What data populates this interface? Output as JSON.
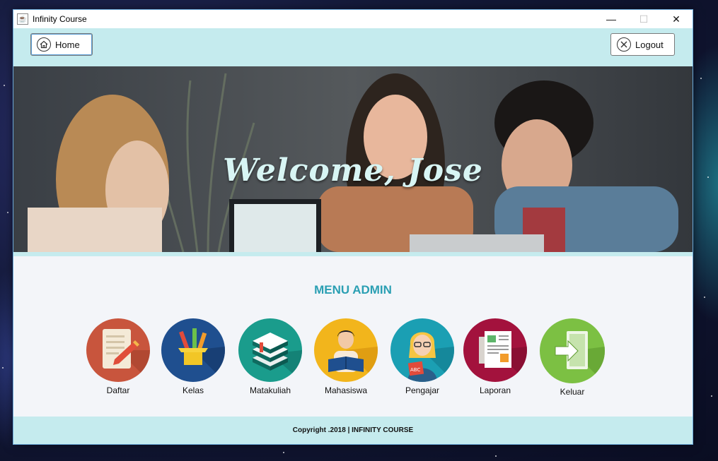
{
  "window": {
    "title": "Infinity Course",
    "controls": {
      "minimize": "—",
      "maximize": "☐",
      "close": "✕"
    }
  },
  "toolbar": {
    "home_label": "Home",
    "logout_label": "Logout"
  },
  "banner": {
    "welcome_text": "Welcome, Jose"
  },
  "menu": {
    "title": "MENU ADMIN",
    "items": [
      {
        "label": "Daftar",
        "icon": "registration-form-icon",
        "color": "#c8553d"
      },
      {
        "label": "Kelas",
        "icon": "pencil-cup-icon",
        "color": "#1f4f8f"
      },
      {
        "label": "Matakuliah",
        "icon": "books-icon",
        "color": "#1a9c8c"
      },
      {
        "label": "Mahasiswa",
        "icon": "student-reading-icon",
        "color": "#f2b51c"
      },
      {
        "label": "Pengajar",
        "icon": "teacher-icon",
        "color": "#1b9fb3"
      },
      {
        "label": "Laporan",
        "icon": "report-document-icon",
        "color": "#a3123d"
      },
      {
        "label": "Keluar",
        "icon": "exit-door-icon",
        "color": "#7cc043"
      }
    ]
  },
  "footer": {
    "copyright": "Copyright .2018 | INFINITY COURSE"
  }
}
